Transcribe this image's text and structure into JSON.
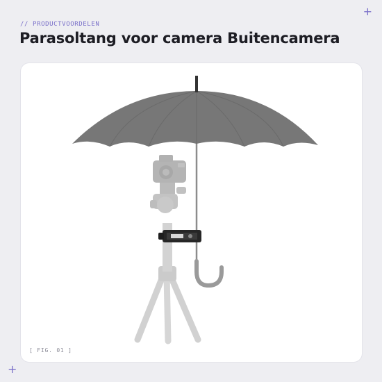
{
  "header": {
    "eyebrow": "// PRODUCTVOORDELEN",
    "title": "Parasoltang voor camera Buitencamera"
  },
  "figure": {
    "caption": "[ FIG. 01 ]",
    "alt": "Parasoltang voor camera Buitencamera"
  },
  "decorations": {
    "corner_mark": "+"
  },
  "colors": {
    "accent": "#7a70c9",
    "background": "#eeeef2",
    "card": "#ffffff",
    "title": "#1d1d24"
  }
}
